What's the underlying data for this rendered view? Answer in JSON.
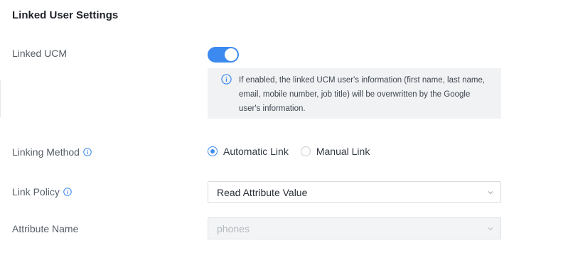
{
  "section": {
    "title": "Linked User Settings"
  },
  "linked_ucm": {
    "label": "Linked UCM",
    "enabled": true,
    "info_text": "If enabled, the linked UCM user's information (first name, last name, email, mobile number, job title) will be overwritten by the Google user's information."
  },
  "linking_method": {
    "label": "Linking Method",
    "options": [
      {
        "label": "Automatic Link",
        "selected": true
      },
      {
        "label": "Manual Link",
        "selected": false
      }
    ]
  },
  "link_policy": {
    "label": "Link Policy",
    "value": "Read Attribute Value"
  },
  "attribute_name": {
    "label": "Attribute Name",
    "value": "phones",
    "disabled": true
  },
  "colors": {
    "accent": "#3c8af0",
    "info_bg": "#f1f2f4",
    "label": "#565e68"
  }
}
